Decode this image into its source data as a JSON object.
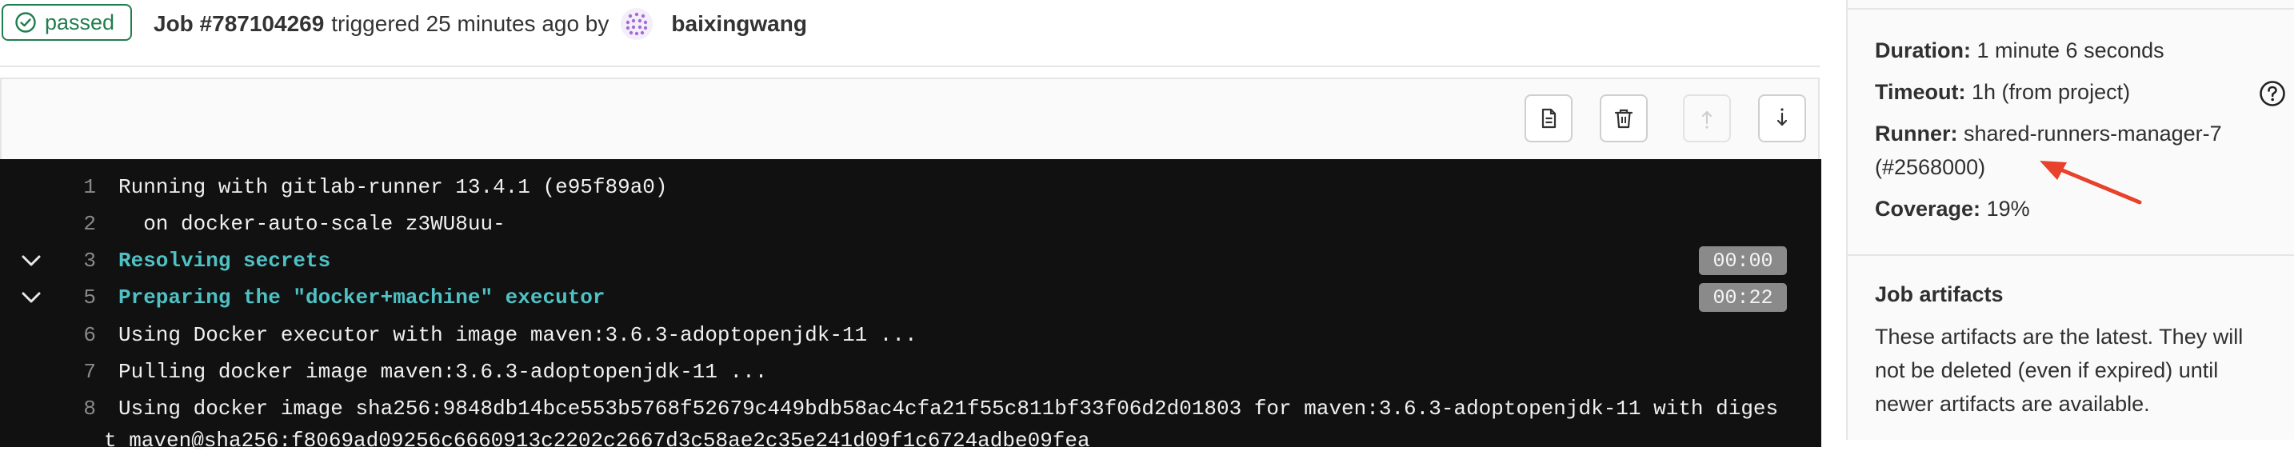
{
  "header": {
    "status": "passed",
    "job_id": "Job #787104269",
    "triggered_text": "triggered 25 minutes ago by",
    "user": "baixingwang"
  },
  "toolbar": {
    "buttons": [
      "raw-log",
      "erase-log",
      "scroll-to-top",
      "scroll-to-bottom"
    ]
  },
  "log": {
    "lines": [
      {
        "num": "1",
        "text": "Running with gitlab-runner 13.4.1 (e95f89a0)",
        "section": false,
        "duration": ""
      },
      {
        "num": "2",
        "text": "  on docker-auto-scale z3WU8uu-",
        "section": false,
        "duration": ""
      },
      {
        "num": "3",
        "text": "Resolving secrets",
        "section": true,
        "duration": "00:00"
      },
      {
        "num": "5",
        "text": "Preparing the \"docker+machine\" executor",
        "section": true,
        "duration": "00:22"
      },
      {
        "num": "6",
        "text": "Using Docker executor with image maven:3.6.3-adoptopenjdk-11 ...",
        "section": false,
        "duration": ""
      },
      {
        "num": "7",
        "text": "Pulling docker image maven:3.6.3-adoptopenjdk-11 ...",
        "section": false,
        "duration": ""
      },
      {
        "num": "8",
        "text": "Using docker image sha256:9848db14bce553b5768f52679c449bdb58ac4cfa21f55c811bf33f06d2d01803 for maven:3.6.3-adoptopenjdk-11 with diges",
        "section": false,
        "duration": ""
      },
      {
        "num": "",
        "text": "t maven@sha256:f8069ad09256c6660913c2202c2667d3c58ae2c35e241d09f1c6724adbe09fea",
        "section": false,
        "duration": ""
      }
    ]
  },
  "sidebar": {
    "duration_label": "Duration:",
    "duration_value": "1 minute 6 seconds",
    "timeout_label": "Timeout:",
    "timeout_value": "1h (from project)",
    "runner_label": "Runner:",
    "runner_value_1": "shared-runners-manager-7",
    "runner_value_2": "(#2568000)",
    "coverage_label": "Coverage:",
    "coverage_value": "19%",
    "artifacts_heading": "Job artifacts",
    "artifacts_text_1": "These artifacts are the latest. They will",
    "artifacts_text_2": "not be deleted (even if expired) until",
    "artifacts_text_3": "newer artifacts are available."
  },
  "colors": {
    "success": "#1f7e4d",
    "log_bg": "#111111",
    "section_text": "#4fc1c4",
    "annotation": "#e8412c"
  },
  "icons": [
    "check-circle-icon",
    "avatar",
    "file-text-icon",
    "trash-icon",
    "arrow-up-icon",
    "arrow-down-icon",
    "chevron-down-icon",
    "question-circle-icon",
    "annotation-arrow"
  ]
}
